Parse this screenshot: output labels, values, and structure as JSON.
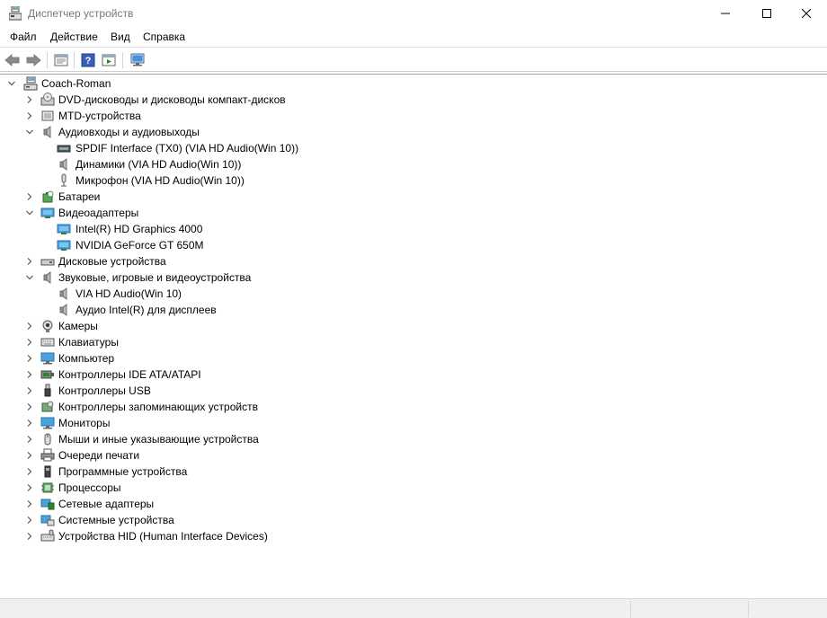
{
  "window": {
    "title": "Диспетчер устройств"
  },
  "menu": [
    "Файл",
    "Действие",
    "Вид",
    "Справка"
  ],
  "tree": {
    "root": "Coach-Roman",
    "nodes": [
      {
        "label": "DVD-дисководы и дисководы компакт-дисков",
        "icon": "dvd-drive-icon",
        "level": 1,
        "state": "collapsed"
      },
      {
        "label": "MTD-устройства",
        "icon": "mtd-device-icon",
        "level": 1,
        "state": "collapsed"
      },
      {
        "label": "Аудиовходы и аудиовыходы",
        "icon": "speaker-icon",
        "level": 1,
        "state": "expanded"
      },
      {
        "label": "SPDIF Interface (TX0) (VIA HD Audio(Win 10))",
        "icon": "spdif-icon",
        "level": 2,
        "state": "leaf"
      },
      {
        "label": "Динамики (VIA HD Audio(Win 10))",
        "icon": "speaker-icon",
        "level": 2,
        "state": "leaf"
      },
      {
        "label": "Микрофон (VIA HD Audio(Win 10))",
        "icon": "microphone-icon",
        "level": 2,
        "state": "leaf"
      },
      {
        "label": "Батареи",
        "icon": "battery-icon",
        "level": 1,
        "state": "collapsed"
      },
      {
        "label": "Видеоадаптеры",
        "icon": "display-adapter-icon",
        "level": 1,
        "state": "expanded"
      },
      {
        "label": "Intel(R) HD Graphics 4000",
        "icon": "display-adapter-icon",
        "level": 2,
        "state": "leaf"
      },
      {
        "label": "NVIDIA GeForce GT 650M",
        "icon": "display-adapter-icon",
        "level": 2,
        "state": "leaf"
      },
      {
        "label": "Дисковые устройства",
        "icon": "disk-drive-icon",
        "level": 1,
        "state": "collapsed"
      },
      {
        "label": "Звуковые, игровые и видеоустройства",
        "icon": "speaker-icon",
        "level": 1,
        "state": "expanded"
      },
      {
        "label": "VIA HD Audio(Win 10)",
        "icon": "speaker-icon",
        "level": 2,
        "state": "leaf"
      },
      {
        "label": "Аудио Intel(R) для дисплеев",
        "icon": "speaker-icon",
        "level": 2,
        "state": "leaf"
      },
      {
        "label": "Камеры",
        "icon": "camera-icon",
        "level": 1,
        "state": "collapsed"
      },
      {
        "label": "Клавиатуры",
        "icon": "keyboard-icon",
        "level": 1,
        "state": "collapsed"
      },
      {
        "label": "Компьютер",
        "icon": "computer-icon",
        "level": 1,
        "state": "collapsed"
      },
      {
        "label": "Контроллеры IDE ATA/ATAPI",
        "icon": "ide-controller-icon",
        "level": 1,
        "state": "collapsed"
      },
      {
        "label": "Контроллеры USB",
        "icon": "usb-icon",
        "level": 1,
        "state": "collapsed"
      },
      {
        "label": "Контроллеры запоминающих устройств",
        "icon": "storage-controller-icon",
        "level": 1,
        "state": "collapsed"
      },
      {
        "label": "Мониторы",
        "icon": "monitor-icon",
        "level": 1,
        "state": "collapsed"
      },
      {
        "label": "Мыши и иные указывающие устройства",
        "icon": "mouse-icon",
        "level": 1,
        "state": "collapsed"
      },
      {
        "label": "Очереди печати",
        "icon": "printer-icon",
        "level": 1,
        "state": "collapsed"
      },
      {
        "label": "Программные устройства",
        "icon": "software-device-icon",
        "level": 1,
        "state": "collapsed"
      },
      {
        "label": "Процессоры",
        "icon": "processor-icon",
        "level": 1,
        "state": "collapsed"
      },
      {
        "label": "Сетевые адаптеры",
        "icon": "network-adapter-icon",
        "level": 1,
        "state": "collapsed"
      },
      {
        "label": "Системные устройства",
        "icon": "system-device-icon",
        "level": 1,
        "state": "collapsed"
      },
      {
        "label": "Устройства HID (Human Interface Devices)",
        "icon": "hid-icon",
        "level": 1,
        "state": "collapsed"
      }
    ]
  },
  "toolbar": [
    "back-arrow-icon",
    "forward-arrow-icon",
    "properties-icon",
    "help-icon",
    "update-driver-icon",
    "scan-hardware-icon"
  ],
  "colors": {
    "accent": "#2f7fd0",
    "chevron": "#555555",
    "title_text": "#777777"
  }
}
